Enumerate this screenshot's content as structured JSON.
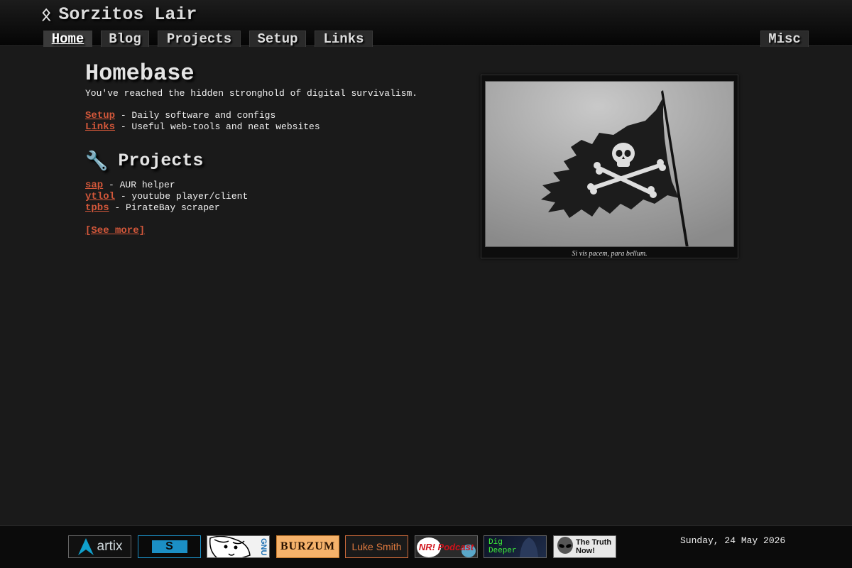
{
  "header": {
    "title": "Sorzitos Lair",
    "logo_icon": "othala-rune-icon",
    "nav": [
      {
        "label": "Home",
        "active": true
      },
      {
        "label": "Blog"
      },
      {
        "label": "Projects"
      },
      {
        "label": "Setup"
      },
      {
        "label": "Links"
      }
    ],
    "nav_right": {
      "label": "Misc"
    }
  },
  "main": {
    "title": "Homebase",
    "lead": "You've reached the hidden stronghold of digital survivalism.",
    "quick_links": [
      {
        "label": "Setup",
        "desc": " - Daily software and configs"
      },
      {
        "label": "Links",
        "desc": " - Useful web-tools and neat websites"
      }
    ],
    "projects_section": {
      "icon": "wrench-icon",
      "title": "Projects",
      "items": [
        {
          "label": "sap",
          "desc": " - AUR helper"
        },
        {
          "label": "ytlol",
          "desc": " - youtube player/client"
        },
        {
          "label": "tpbs",
          "desc": " - PirateBay scraper"
        }
      ],
      "see_more": "[See more]"
    }
  },
  "figure": {
    "image": "jolly-roger-flag",
    "caption": "Si vis pacem, para bellum."
  },
  "footer": {
    "badges": [
      {
        "name": "artix",
        "text": "artix"
      },
      {
        "name": "suckless",
        "text": "S"
      },
      {
        "name": "gnu",
        "text": "GNU"
      },
      {
        "name": "burzum",
        "text": "BURZUM"
      },
      {
        "name": "luke-smith",
        "text": "Luke Smith"
      },
      {
        "name": "nr-podcast",
        "text": "NR! Podcast"
      },
      {
        "name": "dig-deeper",
        "text": "Dig Deeper"
      },
      {
        "name": "the-truth-now",
        "text": "The Truth Now!"
      }
    ],
    "date": "Sunday, 24 May 2026"
  },
  "colors": {
    "background": "#1a1a1a",
    "link": "#d2573a",
    "text": "#f0f0f0"
  }
}
